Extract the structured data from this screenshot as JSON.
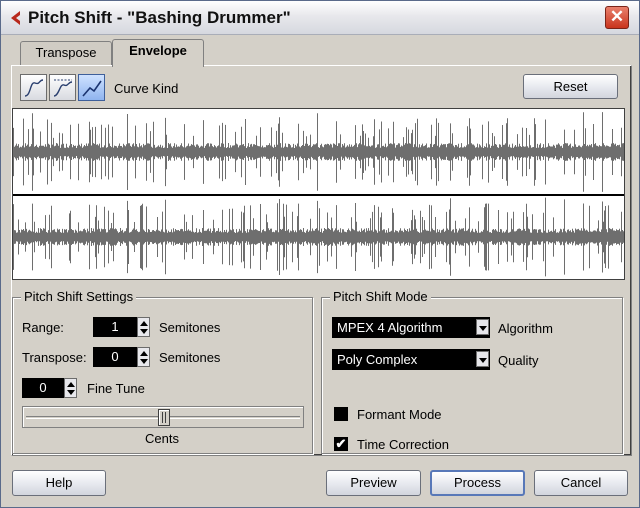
{
  "window": {
    "title": "Pitch Shift - \"Bashing Drummer\"",
    "close_symbol": "✕"
  },
  "tabs": [
    {
      "label": "Transpose",
      "active": false
    },
    {
      "label": "Envelope",
      "active": true
    }
  ],
  "curve_kind": {
    "label": "Curve Kind",
    "buttons": [
      {
        "icon": "spline-curve-icon",
        "selected": false
      },
      {
        "icon": "damped-spline-curve-icon",
        "selected": false
      },
      {
        "icon": "linear-curve-icon",
        "selected": true
      }
    ]
  },
  "reset_label": "Reset",
  "pitch_shift_settings": {
    "title": "Pitch Shift Settings",
    "range_label": "Range:",
    "range_value": "1",
    "range_unit": "Semitones",
    "transpose_label": "Transpose:",
    "transpose_value": "0",
    "transpose_unit": "Semitones",
    "fine_tune_value": "0",
    "fine_tune_label": "Fine Tune",
    "cents_label": "Cents",
    "cents_slider_level": 0.5
  },
  "pitch_shift_mode": {
    "title": "Pitch Shift Mode",
    "algorithm_value": "MPEX 4 Algorithm",
    "algorithm_label": "Algorithm",
    "quality_value": "Poly Complex",
    "quality_label": "Quality",
    "formant_mode_label": "Formant Mode",
    "formant_mode_checked": false,
    "time_correction_label": "Time Correction",
    "time_correction_checked": true,
    "check_symbol": "✔"
  },
  "footer": {
    "help_label": "Help",
    "preview_label": "Preview",
    "process_label": "Process",
    "cancel_label": "Cancel"
  },
  "colors": {
    "window_bg": "#d4d0c8",
    "waveform_color": "#6e6e6e",
    "selected_curve": "#8fb4ef",
    "close_red": "#c9341d"
  }
}
